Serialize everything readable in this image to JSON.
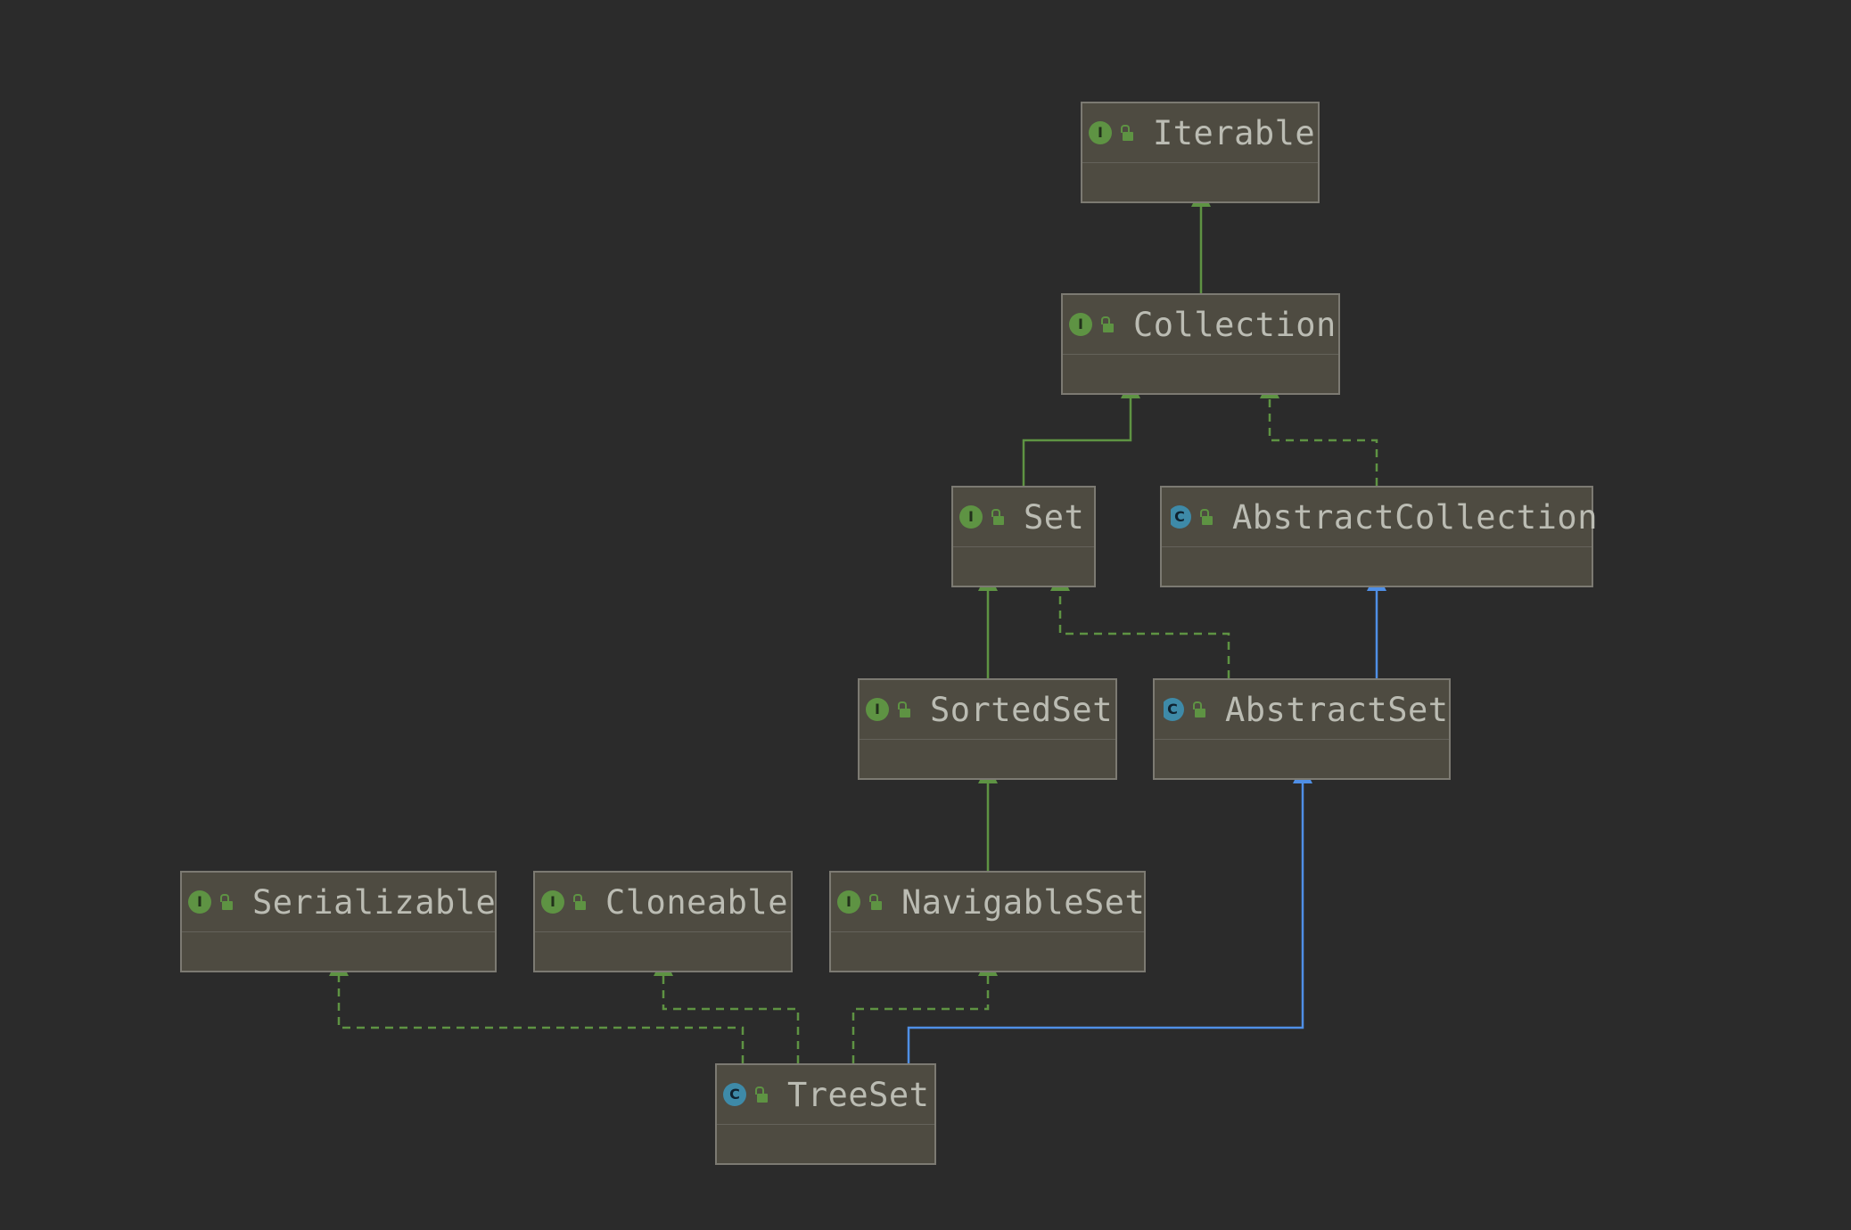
{
  "colors": {
    "background": "#2b2b2b",
    "node_fill": "#4e4b41",
    "node_border": "#7c7a72",
    "interface_edge": "#5e9343",
    "extends_class_edge": "#4f8fe6",
    "interface_icon": "#5e9343",
    "class_icon": "#3e8aa8",
    "text": "#bbbcb3"
  },
  "nodes": [
    {
      "id": "iterable",
      "name": "Iterable",
      "kind": "interface",
      "kind_letter": "I",
      "icon": "interface-icon",
      "access_icon": "public-lock-icon"
    },
    {
      "id": "collection",
      "name": "Collection",
      "kind": "interface",
      "kind_letter": "I",
      "icon": "interface-icon",
      "access_icon": "public-lock-icon"
    },
    {
      "id": "set",
      "name": "Set",
      "kind": "interface",
      "kind_letter": "I",
      "icon": "interface-icon",
      "access_icon": "public-lock-icon"
    },
    {
      "id": "abstractcollection",
      "name": "AbstractCollection",
      "kind": "abstract",
      "kind_letter": "C",
      "icon": "abstract-class-icon",
      "access_icon": "public-lock-icon"
    },
    {
      "id": "sortedset",
      "name": "SortedSet",
      "kind": "interface",
      "kind_letter": "I",
      "icon": "interface-icon",
      "access_icon": "public-lock-icon"
    },
    {
      "id": "abstractset",
      "name": "AbstractSet",
      "kind": "abstract",
      "kind_letter": "C",
      "icon": "abstract-class-icon",
      "access_icon": "public-lock-icon"
    },
    {
      "id": "serializable",
      "name": "Serializable",
      "kind": "interface",
      "kind_letter": "I",
      "icon": "interface-icon",
      "access_icon": "public-lock-icon"
    },
    {
      "id": "cloneable",
      "name": "Cloneable",
      "kind": "interface",
      "kind_letter": "I",
      "icon": "interface-icon",
      "access_icon": "public-lock-icon"
    },
    {
      "id": "navigableset",
      "name": "NavigableSet",
      "kind": "interface",
      "kind_letter": "I",
      "icon": "interface-icon",
      "access_icon": "public-lock-icon"
    },
    {
      "id": "treeset",
      "name": "TreeSet",
      "kind": "class",
      "kind_letter": "C",
      "icon": "class-icon",
      "access_icon": "public-lock-icon"
    }
  ],
  "edges": [
    {
      "from": "collection",
      "to": "iterable",
      "relation": "extends",
      "style": "solid",
      "color": "green"
    },
    {
      "from": "set",
      "to": "collection",
      "relation": "extends",
      "style": "solid",
      "color": "green"
    },
    {
      "from": "abstractcollection",
      "to": "collection",
      "relation": "implements",
      "style": "dashed",
      "color": "green"
    },
    {
      "from": "sortedset",
      "to": "set",
      "relation": "extends",
      "style": "solid",
      "color": "green"
    },
    {
      "from": "abstractset",
      "to": "set",
      "relation": "implements",
      "style": "dashed",
      "color": "green"
    },
    {
      "from": "abstractset",
      "to": "abstractcollection",
      "relation": "extends",
      "style": "solid",
      "color": "blue"
    },
    {
      "from": "navigableset",
      "to": "sortedset",
      "relation": "extends",
      "style": "solid",
      "color": "green"
    },
    {
      "from": "treeset",
      "to": "serializable",
      "relation": "implements",
      "style": "dashed",
      "color": "green"
    },
    {
      "from": "treeset",
      "to": "cloneable",
      "relation": "implements",
      "style": "dashed",
      "color": "green"
    },
    {
      "from": "treeset",
      "to": "navigableset",
      "relation": "implements",
      "style": "dashed",
      "color": "green"
    },
    {
      "from": "treeset",
      "to": "abstractset",
      "relation": "extends",
      "style": "solid",
      "color": "blue"
    }
  ]
}
